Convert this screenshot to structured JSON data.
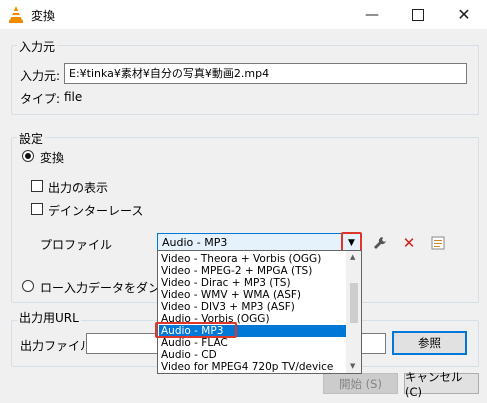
{
  "window": {
    "title": "変換",
    "cone_icon": "vlc-cone-icon",
    "controls": [
      "minimize",
      "maximize",
      "close"
    ]
  },
  "source": {
    "group_label": "入力元",
    "source_label": "入力元:",
    "source_value": "E:¥tinka¥素材¥自分の写真¥動画2.mp4",
    "type_label": "タイプ:",
    "type_value": "file"
  },
  "settings": {
    "group_label": "設定",
    "convert_label": "変換",
    "show_output_label": "出力の表示",
    "deinterlace_label": "デインターレース",
    "profile_label": "プロファイル",
    "profile_selected": "Audio - MP3",
    "dump_raw_label": "ロー入力データをダンプ"
  },
  "profile_options": [
    "Video - Theora + Vorbis (OGG)",
    "Video - MPEG-2 + MPGA (TS)",
    "Video - Dirac + MP3 (TS)",
    "Video - WMV + WMA (ASF)",
    "Video - DIV3 + MP3 (ASF)",
    "Audio - Vorbis (OGG)",
    "Audio - MP3",
    "Audio - FLAC",
    "Audio - CD",
    "Video for MPEG4 720p TV/device"
  ],
  "destination": {
    "group_label": "出力用URL",
    "file_label": "出力ファイル:",
    "file_value": "",
    "browse_label": "参照"
  },
  "footer": {
    "start_label": "開始 (S)",
    "cancel_label": "キャンセル (C)"
  },
  "colors": {
    "accent": "#0078d7",
    "highlight": "#e0352b"
  }
}
